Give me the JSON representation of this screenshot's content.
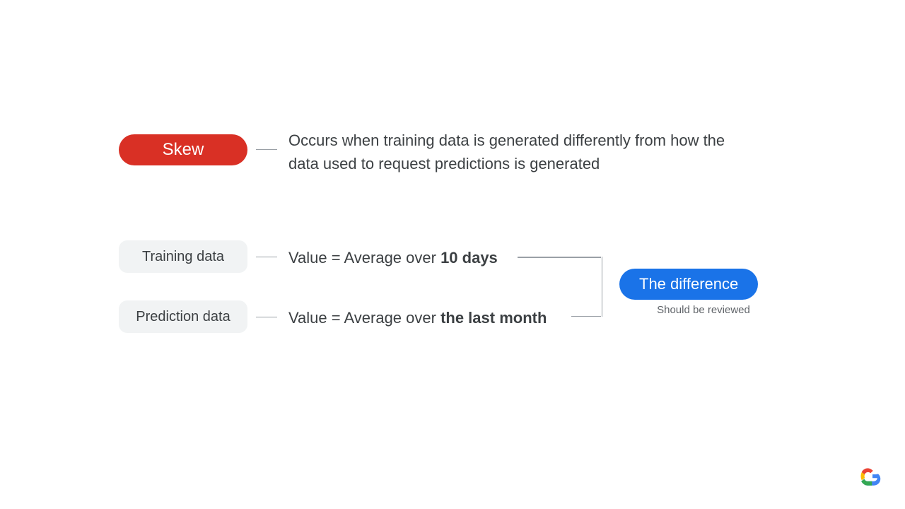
{
  "skew": {
    "label": "Skew",
    "description": "Occurs when training data is generated differently from how the data used to request predictions is generated"
  },
  "training": {
    "label": "Training data",
    "value_prefix": "Value = Average over ",
    "value_bold": "10 days"
  },
  "prediction": {
    "label": "Prediction data",
    "value_prefix": "Value = Average over ",
    "value_bold": "the last month"
  },
  "difference": {
    "label": "The difference",
    "caption": "Should be reviewed"
  }
}
